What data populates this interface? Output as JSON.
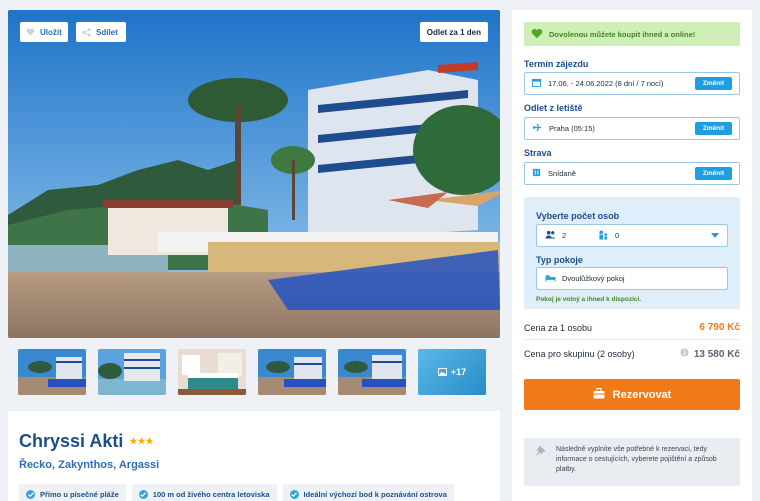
{
  "gallery": {
    "save_label": "Uložit",
    "share_label": "Sdílet",
    "departure_badge": "Odlet za 1 den",
    "more_photos": "+17"
  },
  "hotel": {
    "name": "Chryssi Akti",
    "stars": "★★★",
    "location": "Řecko, Zakynthos, Argassi",
    "tags": [
      "Přímo u písečné pláže",
      "100 m od živého centra letoviska",
      "Ideální výchozí bod k poznávání ostrova"
    ]
  },
  "booking": {
    "alert": "Dovolenou můžete koupit ihned a online!",
    "term_label": "Termín zájezdu",
    "term_value": "17.06. - 24.06.2022 (8 dní / 7 nocí)",
    "departure_label": "Odlet z letiště",
    "departure_value": "Praha (05:15)",
    "board_label": "Strava",
    "board_value": "Snídaně",
    "change_label": "Změnit",
    "persons_label": "Vyberte počet osob",
    "adults": "2",
    "children": "0",
    "room_label": "Typ pokoje",
    "room_value": "Dvoulůžkový pokoj",
    "room_note": "Pokoj je volný a ihned k dispozici.",
    "price_person_label": "Cena za 1 osobu",
    "price_person": "6 790 Kč",
    "price_group_label": "Cena pro skupinu (2 osoby)",
    "price_group": "13 580 Kč",
    "reserve_label": "Rezervovat",
    "hint": "Následně vyplníte vše potřebné k rezervaci, tedy informace o cestujících, vyberete pojištění a způsob platby."
  },
  "colors": {
    "accent": "#1e9fdf",
    "brand": "#1b4f8a",
    "cta": "#ef7a17",
    "success": "#3f8a1f"
  }
}
